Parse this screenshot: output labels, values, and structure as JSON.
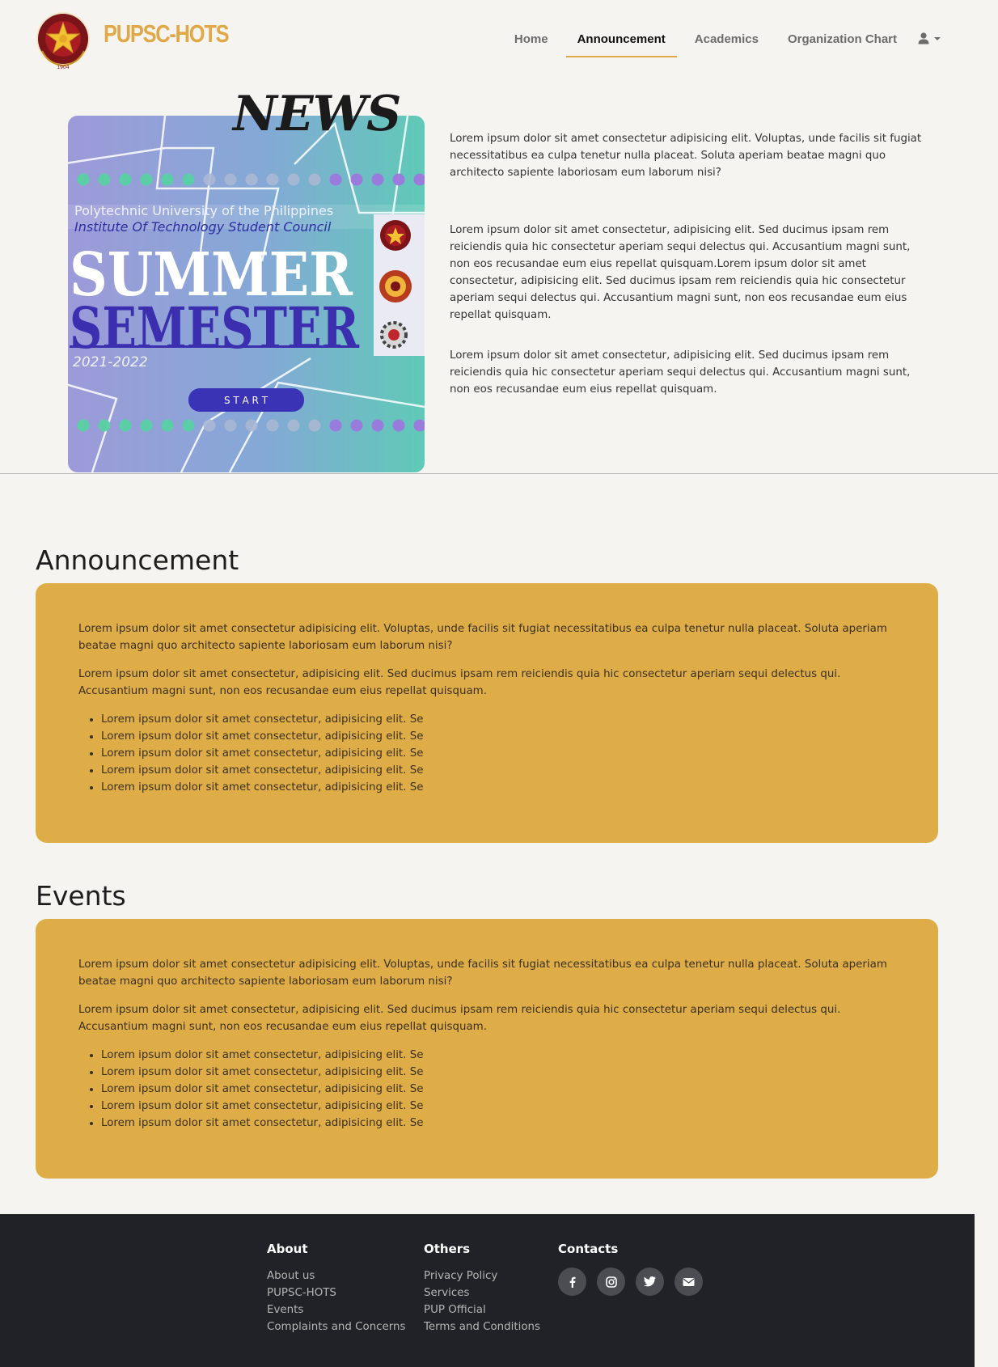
{
  "brand": {
    "name": "PUPSC-HOTS",
    "seal_text": "1904"
  },
  "nav": {
    "items": [
      {
        "label": "Home",
        "active": false
      },
      {
        "label": "Announcement",
        "active": true
      },
      {
        "label": "Academics",
        "active": false
      },
      {
        "label": "Organization Chart",
        "active": false
      }
    ],
    "user_icon": "user-icon"
  },
  "hero": {
    "news_title": "NEWS",
    "poster": {
      "university": "Polytechnic University of the Philippines",
      "council": "Institute Of Technology Student Council",
      "line1": "SUMMER",
      "line2": "SEMESTER",
      "year": "2021-2022",
      "button": "S T A R T"
    },
    "paragraphs": [
      "Lorem ipsum dolor sit amet consectetur adipisicing elit. Voluptas, unde facilis sit fugiat necessitatibus ea culpa tenetur nulla placeat. Soluta aperiam beatae magni quo architecto sapiente laboriosam eum laborum nisi?",
      "Lorem ipsum dolor sit amet consectetur, adipisicing elit. Sed ducimus ipsam rem reiciendis quia hic consectetur aperiam sequi delectus qui. Accusantium magni sunt, non eos recusandae eum eius repellat quisquam.Lorem ipsum dolor sit amet consectetur, adipisicing elit. Sed ducimus ipsam rem reiciendis quia hic consectetur aperiam sequi delectus qui. Accusantium magni sunt, non eos recusandae eum eius repellat quisquam.",
      "Lorem ipsum dolor sit amet consectetur, adipisicing elit. Sed ducimus ipsam rem reiciendis quia hic consectetur aperiam sequi delectus qui. Accusantium magni sunt, non eos recusandae eum eius repellat quisquam."
    ]
  },
  "announcement": {
    "title": "Announcement",
    "p1": "Lorem ipsum dolor sit amet consectetur adipisicing elit. Voluptas, unde facilis sit fugiat necessitatibus ea culpa tenetur nulla placeat. Soluta aperiam beatae magni quo architecto sapiente laboriosam eum laborum nisi?",
    "p2": "Lorem ipsum dolor sit amet consectetur, adipisicing elit. Sed ducimus ipsam rem reiciendis quia hic consectetur aperiam sequi delectus qui. Accusantium magni sunt, non eos recusandae eum eius repellat quisquam.",
    "items": [
      "Lorem ipsum dolor sit amet consectetur, adipisicing elit. Se",
      "Lorem ipsum dolor sit amet consectetur, adipisicing elit. Se",
      "Lorem ipsum dolor sit amet consectetur, adipisicing elit. Se",
      "Lorem ipsum dolor sit amet consectetur, adipisicing elit. Se",
      "Lorem ipsum dolor sit amet consectetur, adipisicing elit. Se"
    ]
  },
  "events": {
    "title": "Events",
    "p1": "Lorem ipsum dolor sit amet consectetur adipisicing elit. Voluptas, unde facilis sit fugiat necessitatibus ea culpa tenetur nulla placeat. Soluta aperiam beatae magni quo architecto sapiente laboriosam eum laborum nisi?",
    "p2": "Lorem ipsum dolor sit amet consectetur, adipisicing elit. Sed ducimus ipsam rem reiciendis quia hic consectetur aperiam sequi delectus qui. Accusantium magni sunt, non eos recusandae eum eius repellat quisquam.",
    "items": [
      "Lorem ipsum dolor sit amet consectetur, adipisicing elit. Se",
      "Lorem ipsum dolor sit amet consectetur, adipisicing elit. Se",
      "Lorem ipsum dolor sit amet consectetur, adipisicing elit. Se",
      "Lorem ipsum dolor sit amet consectetur, adipisicing elit. Se",
      "Lorem ipsum dolor sit amet consectetur, adipisicing elit. Se"
    ]
  },
  "footer": {
    "about": {
      "title": "About",
      "links": [
        "About us",
        "PUPSC-HOTS",
        "Events",
        "Complaints and Concerns"
      ]
    },
    "others": {
      "title": "Others",
      "links": [
        "Privacy Policy",
        "Services",
        "PUP Official",
        "Terms and Conditions"
      ]
    },
    "contacts": {
      "title": "Contacts",
      "icons": [
        "facebook-icon",
        "instagram-icon",
        "twitter-icon",
        "email-icon"
      ]
    }
  },
  "colors": {
    "accent": "#dfad48",
    "brand": "#e0a847",
    "footer_bg": "#202227",
    "page_bg": "#f5f4f0"
  }
}
